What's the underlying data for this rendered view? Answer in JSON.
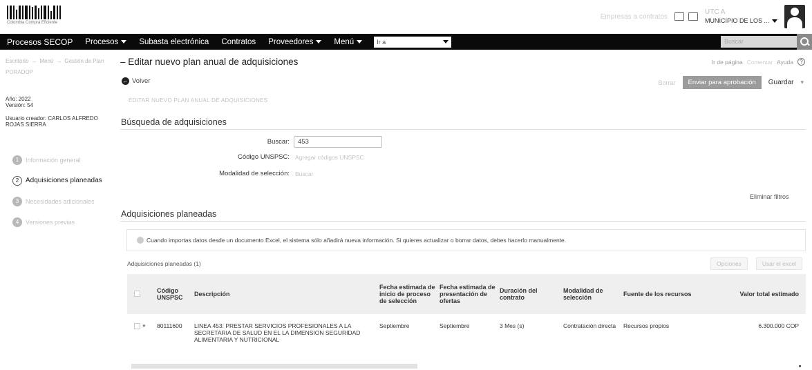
{
  "header": {
    "logo_caption": "Colombia Compra Eficiente",
    "faint_link": "Empresas a contratos",
    "user_name": "UTC A",
    "entity": "MUNICIPIO DE LOS ..."
  },
  "nav": {
    "brand": "Procesos SECOP",
    "items": [
      {
        "label": "Procesos",
        "caret": true
      },
      {
        "label": "Subasta electrónica",
        "caret": false
      },
      {
        "label": "Contratos",
        "caret": false
      },
      {
        "label": "Proveedores",
        "caret": true
      },
      {
        "label": "Menú",
        "caret": true
      }
    ],
    "goto_value": "Ir a",
    "search_placeholder": "Buscar"
  },
  "breadcrumb": {
    "items": [
      "Escritorio",
      "Menú",
      "Gestión de Plan"
    ]
  },
  "page": {
    "title": "– Editar nuevo plan anual de adquisiciones",
    "help_a": "Ir de página",
    "help_b": "Comentar",
    "help_c": "Ayuda"
  },
  "left_panel": {
    "code": "PORADOP",
    "year": "Año: 2022",
    "version": "Versión: 54",
    "user_label": "Usuario creador: CARLOS ALFREDO ROJAS SIERRA",
    "steps": [
      {
        "num": "1",
        "label": "Información general",
        "active": false
      },
      {
        "num": "2",
        "label": "Adquisiciones planeadas",
        "active": true
      },
      {
        "num": "3",
        "label": "Necesidades adicionales",
        "active": false
      },
      {
        "num": "4",
        "label": "Versiones previas",
        "active": false
      }
    ]
  },
  "actions": {
    "back": "Volver",
    "faint": "Borrar",
    "approve": "Enviar para aprobación",
    "save": "Guardar"
  },
  "sub_heading": "EDITAR NUEVO PLAN ANUAL DE ADQUISICIONES",
  "search_section": {
    "title": "Búsqueda de adquisiciones",
    "buscar_label": "Buscar:",
    "buscar_value": "453",
    "unspsc_label": "Código UNSPSC:",
    "unspsc_link": "Agregar códigos UNSPSC",
    "modalidad_label": "Modalidad de selección:",
    "modalidad_link": "Buscar",
    "clear_filters": "Eliminar filtros"
  },
  "planned_section": {
    "title": "Adquisiciones planeadas",
    "notice": "Cuando importas datos desde un documento Excel, el sistema sólo añadirá nueva información. Si quieres actualizar o borrar datos, debes hacerlo manualmente.",
    "count_label": "Adquisiciones planeadas (1)",
    "options_btn": "Opciones",
    "excel_btn": "Usar el excel"
  },
  "table": {
    "headers": {
      "code": "Código UNSPSC",
      "desc": "Descripción",
      "start": "Fecha estimada de inicio de proceso de selección",
      "offers": "Fecha estimada de presentación de ofertas",
      "duration": "Duración del contrato",
      "modality": "Modalidad de selección",
      "source": "Fuente de los recursos",
      "value": "Valor total estimado"
    },
    "rows": [
      {
        "code": "80111600",
        "desc": "LINEA 453: PRESTAR SERVICIOS PROFESIONALES A LA SECRETARIA DE SALUD EN EL LA DIMENSION SEGURIDAD ALIMENTARIA Y NUTRICIONAL",
        "start": "Septiembre",
        "offers": "Septiembre",
        "duration": "3 Mes (s)",
        "modality": "Contratación directa",
        "source": "Recursos propios",
        "value": "6.300.000 COP"
      }
    ]
  }
}
